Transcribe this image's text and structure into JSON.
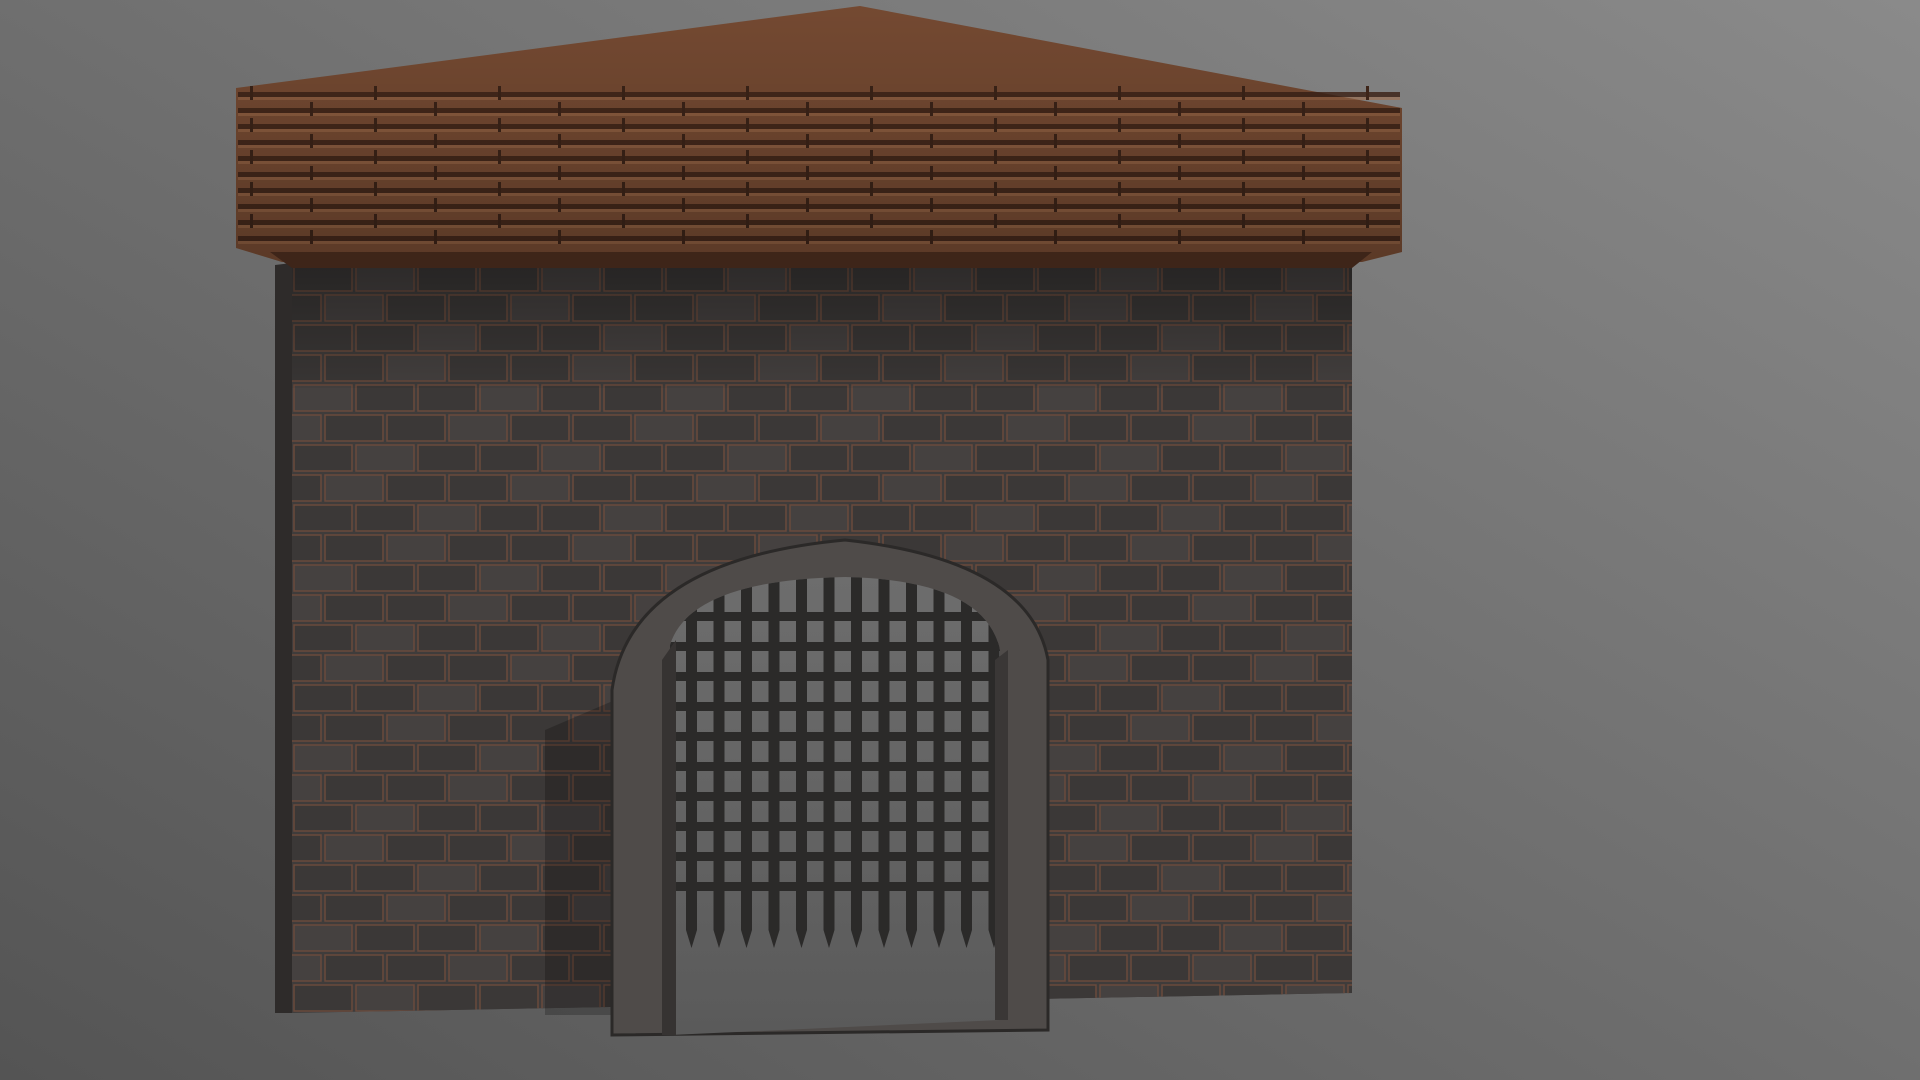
{
  "scene": {
    "subject": "gatehouse",
    "colors": {
      "background_light": "#8a8a8a",
      "background_dark": "#545454",
      "roof_base": "#7a4d34",
      "roof_highlight": "#a06e4c",
      "roof_shadow": "#3e2519",
      "wall_base": "#3f3c3b",
      "mortar": "#6a4a3c",
      "upper_band": "#2f2b2a",
      "arch_frame": "#4f4b49",
      "portcullis": "#2b2a29",
      "opening": "#646464"
    },
    "elements": {
      "roof": "roof-shingles",
      "wall": "brick-wall",
      "gate": "portcullis-gate"
    }
  }
}
